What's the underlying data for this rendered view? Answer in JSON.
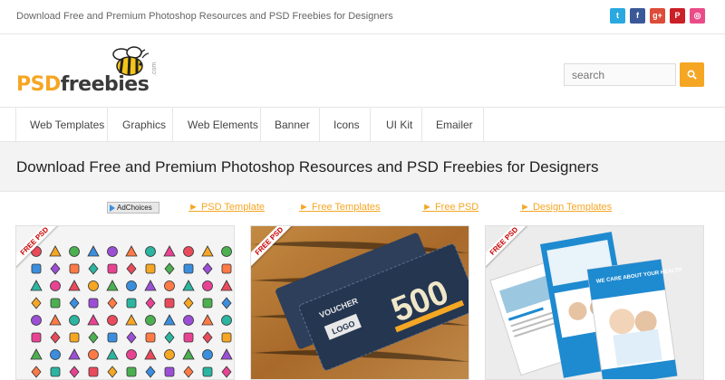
{
  "topbar": {
    "tagline": "Download Free and Premium Photoshop Resources and PSD Freebies for Designers",
    "social": [
      {
        "icon": "twitter-icon",
        "glyph": "t",
        "color": "#2aa9e0"
      },
      {
        "icon": "facebook-icon",
        "glyph": "f",
        "color": "#3b5998"
      },
      {
        "icon": "google-plus-icon",
        "glyph": "g+",
        "color": "#dd4b39"
      },
      {
        "icon": "pinterest-icon",
        "glyph": "P",
        "color": "#cb2027"
      },
      {
        "icon": "dribbble-icon",
        "glyph": "◎",
        "color": "#ea4c89"
      }
    ]
  },
  "logo": {
    "psd": "PSD",
    "freebies": "freebies",
    "dotcom": ".com"
  },
  "search": {
    "placeholder": "search"
  },
  "nav": {
    "items": [
      "Web Templates",
      "Graphics",
      "Web Elements",
      "Banner",
      "Icons",
      "UI Kit",
      "Emailer"
    ]
  },
  "banner": {
    "title": "Download Free and Premium Photoshop Resources and PSD Freebies for Designers"
  },
  "ads": {
    "adchoices": "AdChoices",
    "links": [
      "► PSD Template",
      "► Free Templates",
      "► Free PSD",
      "► Design Templates"
    ]
  },
  "cards": {
    "ribbon": "FREE PSD",
    "voucher_word": "VOUCHER",
    "voucher_amount": "500",
    "voucher_logo": "LOGO",
    "medical_caption": "WE CARE ABOUT YOUR HEALTH"
  },
  "colors": {
    "accent": "#f5a623",
    "text_dark": "#222222",
    "link": "#f5a623"
  }
}
